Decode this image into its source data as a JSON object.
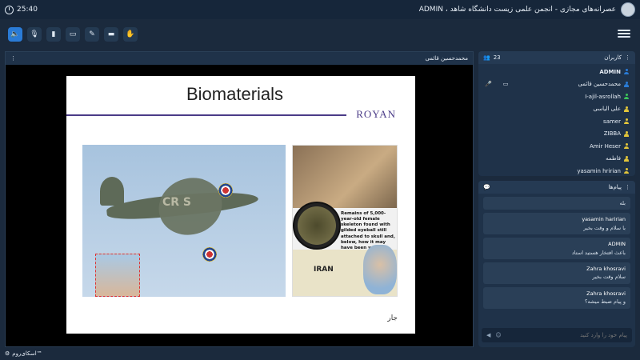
{
  "header": {
    "clock": "25:40",
    "title": "ADMIN ، عصرانه‌های مجازی - انجمن علمی زیست دانشگاه شاهد"
  },
  "toolbar": {
    "buttons": [
      "speaker-icon",
      "mic-off-icon",
      "camera-off-icon",
      "screen-share-icon",
      "pen-icon",
      "folder-icon",
      "hand-icon"
    ]
  },
  "video": {
    "presenter": "محمدحسین قائمی"
  },
  "slide": {
    "title": "Biomaterials",
    "brand": "ROYAN",
    "plane_text": "CR   S",
    "news_text": "Remains of 5,000-year-old female skeleton found with gilded eyeball still attached to skull and, below, how it may have been worn",
    "map_label": "IRAN",
    "logo": "جار"
  },
  "users": {
    "title": "کاربران",
    "count": "23",
    "items": [
      {
        "name": "ADMIN",
        "color": "#2a7bd6",
        "bold": true
      },
      {
        "name": "محمدحسین قائمی",
        "color": "#2a7bd6",
        "mic": true
      },
      {
        "name": "I-ajil-asrollah",
        "color": "#3cc45a"
      },
      {
        "name": "علی الیاسی",
        "color": "#e2c53a"
      },
      {
        "name": "samer",
        "color": "#e2c53a"
      },
      {
        "name": "ZIBBA",
        "color": "#e2c53a"
      },
      {
        "name": "Amir Heser",
        "color": "#e2c53a"
      },
      {
        "name": "فاطمه",
        "color": "#e2c53a"
      },
      {
        "name": "yasamin hririan",
        "color": "#e2c53a"
      }
    ]
  },
  "chat": {
    "title": "پیام‌ها",
    "first_line": "بله",
    "messages": [
      {
        "sender": "yasamin haririan",
        "text": "با سلام و وقت بخیر"
      },
      {
        "sender": "ADMIN",
        "text": "باعث افتخار هستید استاد"
      },
      {
        "sender": "Zahra khosravi",
        "text": "سلام وقت بخیر"
      },
      {
        "sender": "Zahra khosravi",
        "text": "و پیام ضبط میشه؟"
      }
    ],
    "input_placeholder": "پیام خود را وارد کنید"
  },
  "footer": {
    "brand": "اسکای‌روم™"
  }
}
